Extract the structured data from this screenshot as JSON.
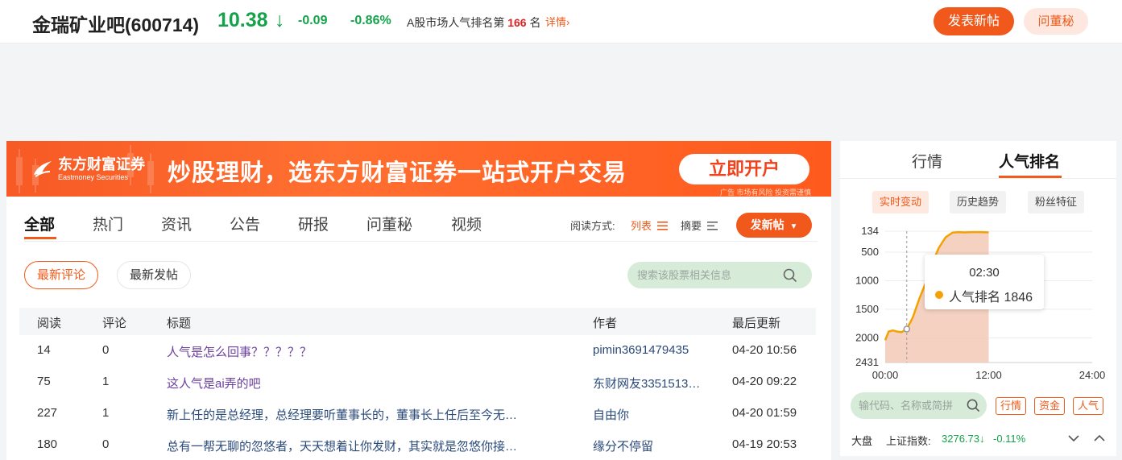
{
  "header": {
    "stock_name": "金瑞矿业吧(600714)",
    "price": "10.38",
    "price_arrow": "↓",
    "change": "-0.09",
    "change_pct": "-0.86%",
    "rank_prefix": "A股市场人气排名第",
    "rank_value": "166",
    "rank_suffix": "名",
    "detail_link": "详情",
    "post_button": "发表新帖",
    "ask_secretary_button": "问董秘",
    "colors": {
      "down": "#14a34a",
      "accent": "#f0581c",
      "rank": "#e02020"
    }
  },
  "banner": {
    "logo_cn": "东方财富证券",
    "logo_en": "Eastmoney Securities",
    "slogan": "炒股理财，选东方财富证券一站式开户交易",
    "cta": "立即开户",
    "ad_note": "广告 市场有风险 投资需谨慎"
  },
  "main": {
    "tabs": [
      "全部",
      "热门",
      "资讯",
      "公告",
      "研报",
      "问董秘",
      "视频"
    ],
    "active_tab": "全部",
    "read_mode_label": "阅读方式:",
    "mode_list": "列表",
    "mode_summary": "摘要",
    "new_post_button": "发新帖",
    "filters": [
      "最新评论",
      "最新发帖"
    ],
    "search_placeholder": "搜索该股票相关信息",
    "table": {
      "headers": [
        "阅读",
        "评论",
        "标题",
        "作者",
        "最后更新"
      ],
      "rows": [
        {
          "read": "14",
          "comments": "0",
          "title": "人气是怎么回事？？？？？",
          "author": "pimin3691479435",
          "time": "04-20 10:56",
          "visited": true
        },
        {
          "read": "75",
          "comments": "1",
          "title": "这人气是ai弄的吧",
          "author": "东财网友3351513…",
          "time": "04-20 09:22",
          "visited": true
        },
        {
          "read": "227",
          "comments": "1",
          "title": "新上任的是总经理，总经理要听董事长的，董事长上任后至今无…",
          "author": "自由你",
          "time": "04-20 01:59",
          "visited": false
        },
        {
          "read": "180",
          "comments": "0",
          "title": "总有一帮无聊的忽悠者，天天想着让你发财，其实就是忽悠你接…",
          "author": "缘分不停留",
          "time": "04-19 20:53",
          "visited": false
        }
      ]
    }
  },
  "right": {
    "tabs": [
      "行情",
      "人气排名"
    ],
    "active_tab": "人气排名",
    "subtabs": [
      "实时变动",
      "历史趋势",
      "粉丝特征"
    ],
    "chart_data": {
      "type": "line",
      "y_ticks": [
        "134",
        "500",
        "1000",
        "1500",
        "2000",
        "2431"
      ],
      "x_ticks": [
        "00:00",
        "12:00",
        "24:00"
      ],
      "ylim": [
        2431,
        134
      ],
      "y_reversed": true,
      "x_hours": [
        0,
        0.4,
        0.9,
        1.4,
        1.9,
        2.5,
        3.2,
        4.0,
        4.8,
        5.5,
        6.2,
        7.0,
        7.8,
        8.5,
        9.2,
        10.0,
        11.0,
        12.0
      ],
      "rank": [
        2040,
        1890,
        1870,
        1890,
        1900,
        1846,
        1640,
        1300,
        1000,
        680,
        430,
        240,
        160,
        150,
        155,
        150,
        150,
        155
      ],
      "marker_x": 2.5,
      "series_color": "#f5a100",
      "fill_color": "#f2c9b5"
    },
    "tooltip": {
      "time": "02:30",
      "label": "人气排名 1846"
    },
    "search_placeholder": "输代码、名称或简拼",
    "quick_buttons": [
      "行情",
      "资金",
      "人气"
    ],
    "index": {
      "label": "大盘",
      "name": "上证指数:",
      "value": "3276.73↓",
      "change": "-0.11%"
    }
  }
}
